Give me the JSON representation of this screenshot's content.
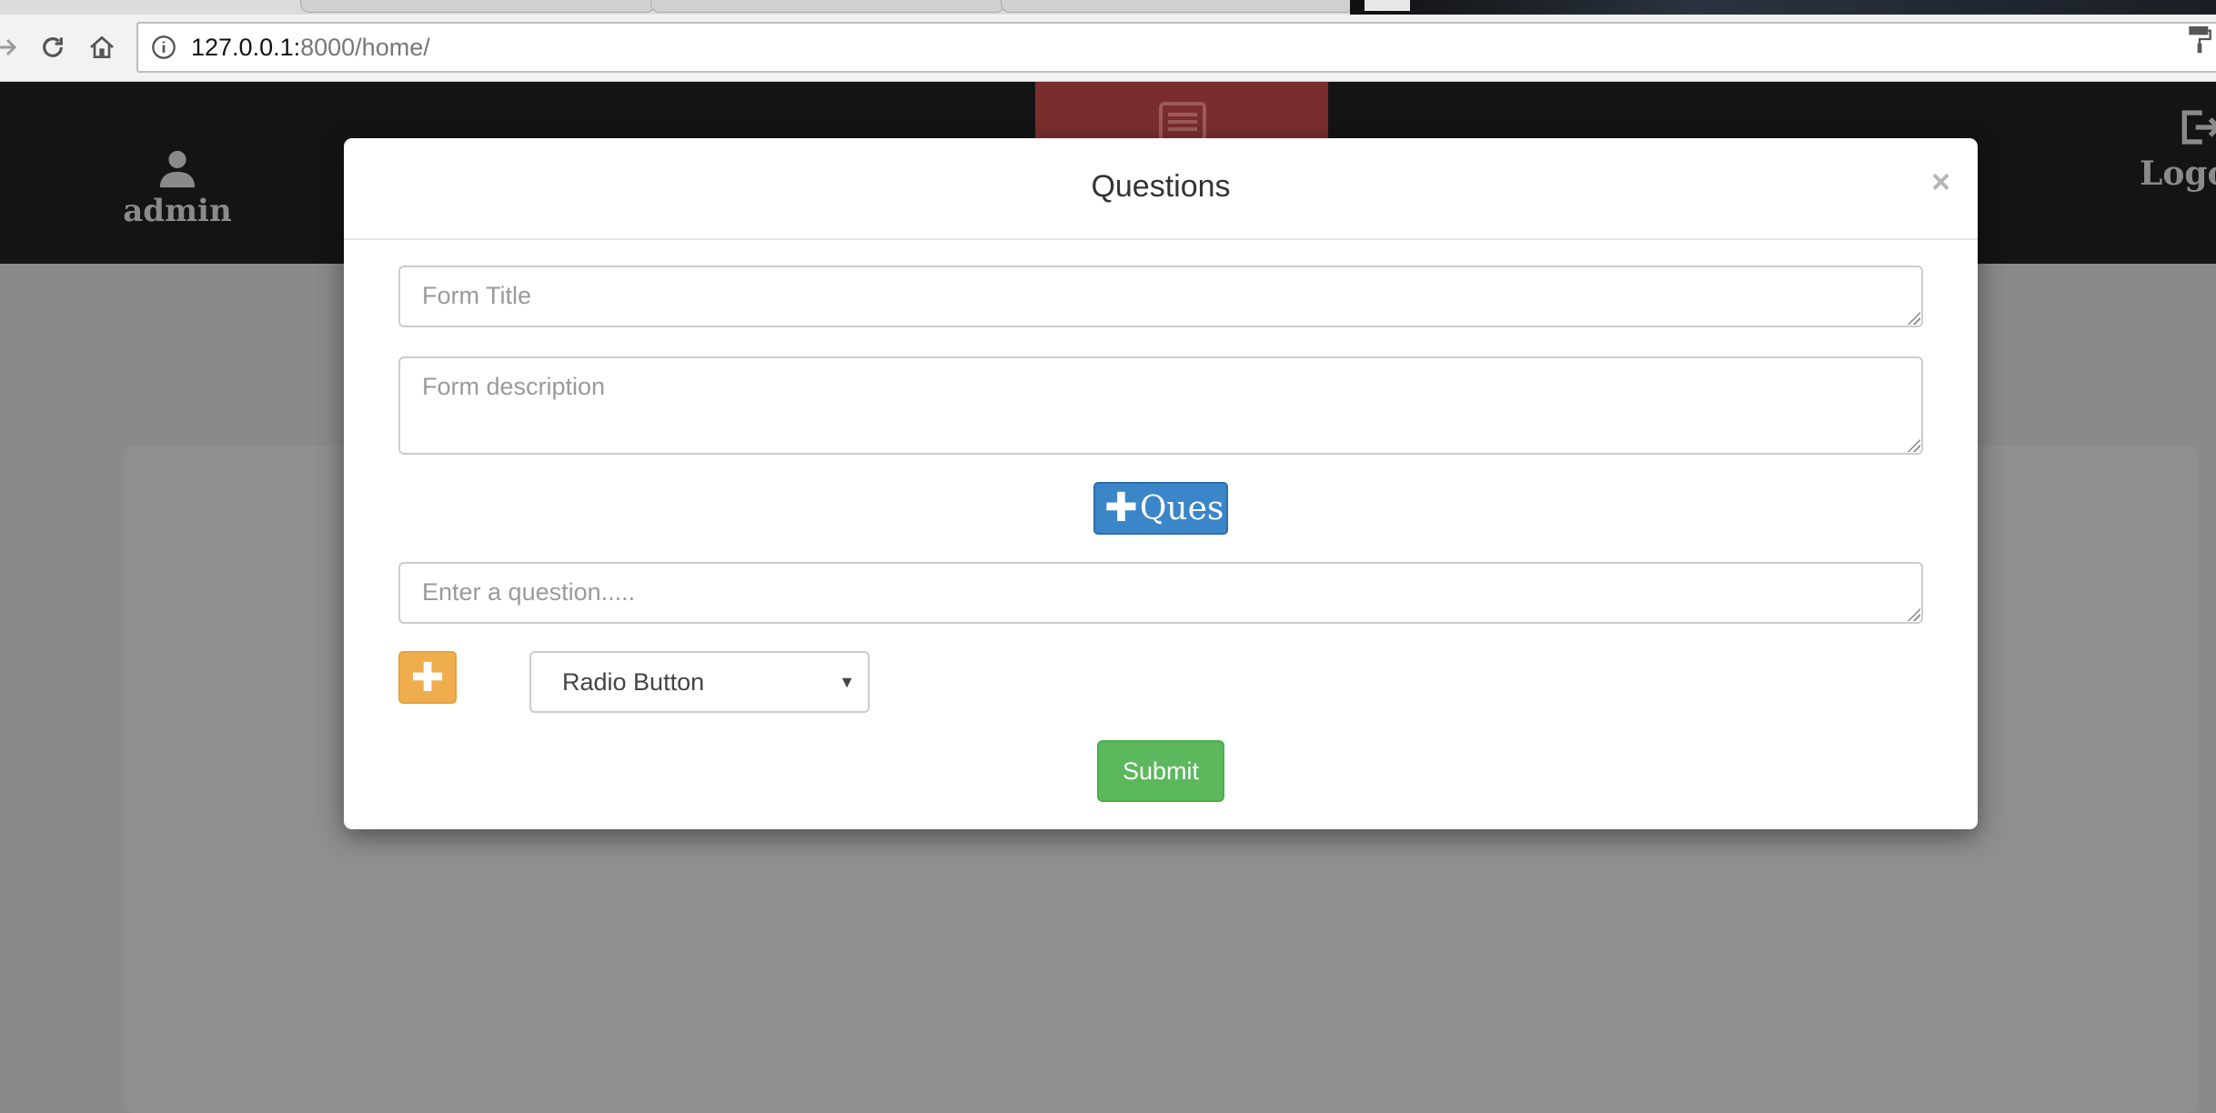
{
  "browser": {
    "url_host": "127.0.0.1:",
    "url_rest": "8000/home/"
  },
  "header": {
    "username": "admin",
    "logout_label": "Logo"
  },
  "modal": {
    "title": "Questions",
    "close_symbol": "×",
    "form_title_placeholder": "Form Title",
    "form_description_placeholder": "Form description",
    "add_question_label": "Ques",
    "add_question_icon": "plus-icon",
    "question_placeholder": "Enter a question.....",
    "add_option_icon": "plus-icon",
    "question_type": {
      "selected": "Radio Button"
    },
    "submit_label": "Submit"
  },
  "colors": {
    "header_bg": "#141414",
    "active_tab": "#7a2d2d",
    "primary": "#3a86c8",
    "warning": "#f0ad4e",
    "success": "#5cb85c",
    "backdrop": "#8a8a8a"
  }
}
